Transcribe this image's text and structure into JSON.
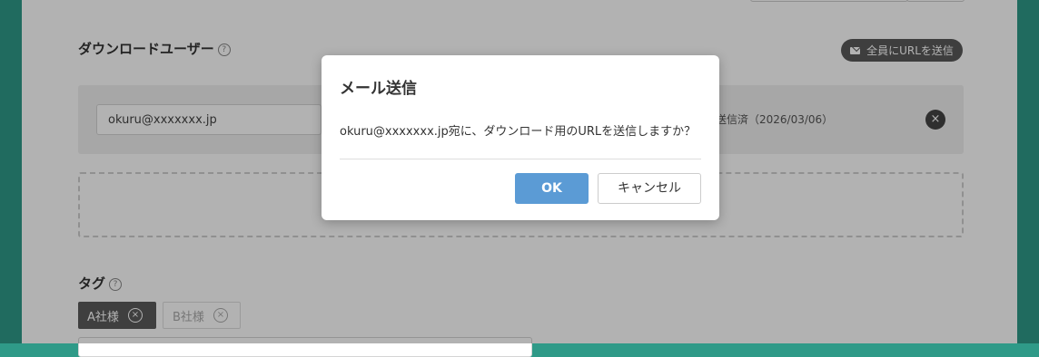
{
  "download_users": {
    "section_title": "ダウンロードユーザー",
    "help_icon": "?",
    "mail_all_label": "全員にURLを送信",
    "users": [
      {
        "email": "okuru@xxxxxxx.jp",
        "status": "送信済（2026/03/06）"
      }
    ],
    "remove_icon": "×"
  },
  "tags": {
    "section_title": "タグ",
    "help_icon": "?",
    "items": [
      {
        "label": "A社様",
        "active": true
      },
      {
        "label": "B社様",
        "active": false
      }
    ],
    "remove_icon": "×"
  },
  "dialog": {
    "title": "メール送信",
    "message": "okuru@xxxxxxx.jp宛に、ダウンロード用のURLを送信しますか？",
    "ok_label": "OK",
    "cancel_label": "キャンセル"
  },
  "colors": {
    "accent_green": "#2f9a88",
    "primary_button": "#5b9bd5",
    "dark_button": "#5a5a5a"
  },
  "icons": [
    "help-icon",
    "envelope-icon",
    "close-circle-icon"
  ]
}
